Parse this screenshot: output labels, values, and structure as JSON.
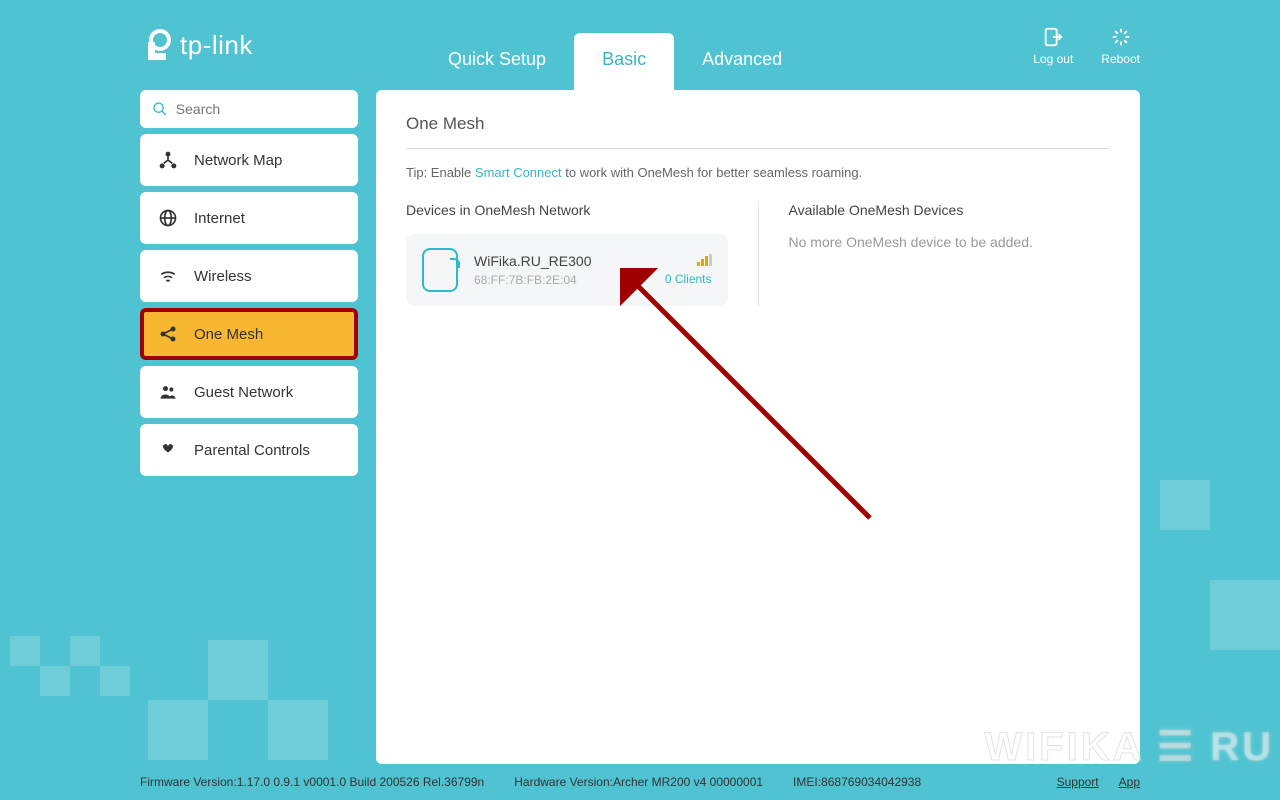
{
  "brand": "tp-link",
  "tabs": {
    "quick": "Quick Setup",
    "basic": "Basic",
    "advanced": "Advanced"
  },
  "topActions": {
    "logout": "Log out",
    "reboot": "Reboot"
  },
  "search": {
    "placeholder": "Search"
  },
  "sidebar": {
    "items": [
      {
        "label": "Network Map"
      },
      {
        "label": "Internet"
      },
      {
        "label": "Wireless"
      },
      {
        "label": "One Mesh"
      },
      {
        "label": "Guest Network"
      },
      {
        "label": "Parental Controls"
      }
    ]
  },
  "page": {
    "title": "One Mesh",
    "tip_pre": "Tip: Enable ",
    "tip_link": "Smart Connect",
    "tip_post": " to work with OneMesh for better seamless roaming.",
    "col1_title": "Devices in OneMesh Network",
    "col2_title": "Available OneMesh Devices",
    "empty": "No more OneMesh device to be added."
  },
  "device": {
    "name": "WiFika.RU_RE300",
    "mac": "68:FF:7B:FB:2E:04",
    "clients": "0 Clients"
  },
  "footer": {
    "fw": "Firmware Version:1.17.0 0.9.1 v0001.0 Build 200526 Rel.36799n",
    "hw": "Hardware Version:Archer MR200 v4 00000001",
    "imei": "IMEI:868769034042938",
    "support": "Support",
    "app": "App"
  },
  "watermark": "WIFIKA ☰ RU"
}
